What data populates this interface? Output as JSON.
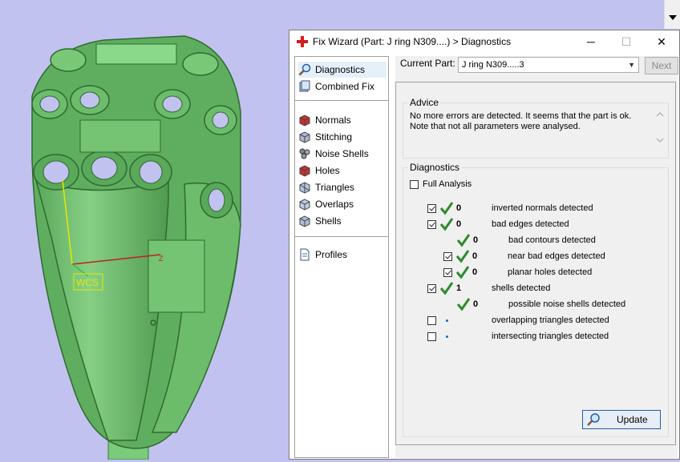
{
  "dialog": {
    "title": "Fix Wizard (Part: J ring N309....) > Diagnostics",
    "minimize": "─",
    "maximize": "☐",
    "close": "✕"
  },
  "viewport": {
    "wcs_label": "WCS",
    "axis_z": "Z"
  },
  "nav": {
    "items": [
      {
        "label": "Diagnostics",
        "icon": "diagnostics-magnifier-icon",
        "selected": true
      },
      {
        "label": "Combined Fix",
        "icon": "combined-fix-icon"
      },
      {
        "label": "Normals",
        "icon": "normals-cube-icon"
      },
      {
        "label": "Stitching",
        "icon": "stitching-cube-icon"
      },
      {
        "label": "Noise Shells",
        "icon": "noise-shells-icon"
      },
      {
        "label": "Holes",
        "icon": "holes-cube-icon"
      },
      {
        "label": "Triangles",
        "icon": "triangles-cube-icon"
      },
      {
        "label": "Overlaps",
        "icon": "overlaps-cube-icon"
      },
      {
        "label": "Shells",
        "icon": "shells-cube-icon"
      },
      {
        "label": "Profiles",
        "icon": "profiles-document-icon"
      }
    ]
  },
  "current_part": {
    "label": "Current Part:",
    "value": "J ring N309.....3"
  },
  "next_label": "Next",
  "advice": {
    "title": "Advice",
    "line1": "No more errors are detected. It seems that the part is ok.",
    "line2": "Note that not all parameters were analysed."
  },
  "diagnostics": {
    "title": "Diagnostics",
    "full_analysis": "Full Analysis",
    "rows": [
      {
        "checked": true,
        "ok": true,
        "count": "0",
        "label": "inverted normals detected"
      },
      {
        "checked": true,
        "ok": true,
        "count": "0",
        "label": "bad edges detected"
      },
      {
        "checked": null,
        "ok": true,
        "count": "0",
        "label": "bad contours detected"
      },
      {
        "checked": true,
        "ok": true,
        "count": "0",
        "label": "near bad edges detected"
      },
      {
        "checked": true,
        "ok": true,
        "count": "0",
        "label": "planar holes detected"
      },
      {
        "checked": true,
        "ok": true,
        "count": "1",
        "label": "shells detected"
      },
      {
        "checked": null,
        "ok": true,
        "count": "0",
        "label": "possible noise shells detected"
      },
      {
        "checked": false,
        "ok": false,
        "count": "",
        "label": "overlapping triangles detected"
      },
      {
        "checked": false,
        "ok": false,
        "count": "",
        "label": "intersecting triangles detected"
      }
    ]
  },
  "update_label": "Update",
  "colors": {
    "viewport_bg": "#c2c2f0",
    "model_green": "#6fbf6f",
    "check_green": "#2e8b2e",
    "selection_bg": "#e5f0fb"
  }
}
